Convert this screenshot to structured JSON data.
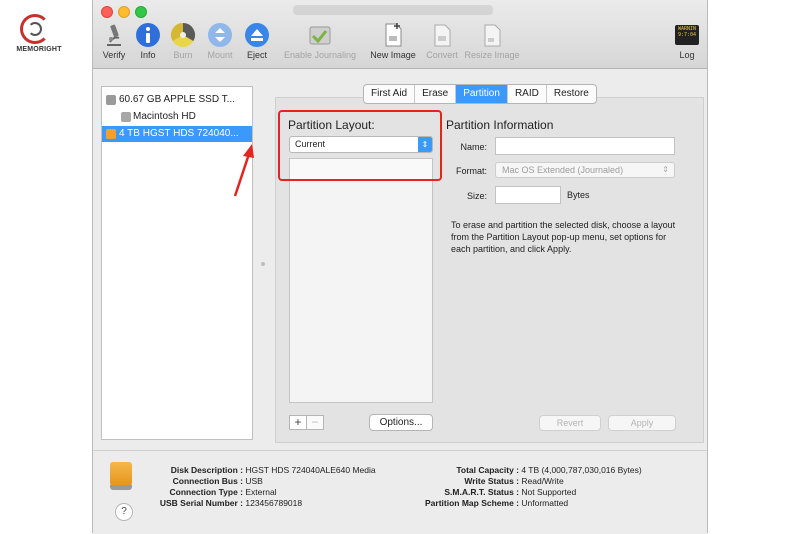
{
  "watermark": {
    "text": "MEMORIGHT"
  },
  "toolbar": {
    "items": [
      {
        "label": "Verify",
        "icon": "microscope-icon"
      },
      {
        "label": "Info",
        "icon": "info-icon"
      },
      {
        "label": "Burn",
        "icon": "burn-icon"
      },
      {
        "label": "Mount",
        "icon": "mount-icon"
      },
      {
        "label": "Eject",
        "icon": "eject-icon"
      },
      {
        "label": "Enable Journaling",
        "icon": "journaling-icon"
      },
      {
        "label": "New Image",
        "icon": "new-image-icon"
      },
      {
        "label": "Convert",
        "icon": "convert-icon"
      },
      {
        "label": "Resize Image",
        "icon": "resize-image-icon"
      },
      {
        "label": "Log",
        "icon": "log-icon"
      }
    ],
    "log_badge": "WARNIN 9:7:04"
  },
  "sidebar": {
    "items": [
      {
        "label": "60.67 GB APPLE SSD T..."
      },
      {
        "label": "Macintosh HD"
      },
      {
        "label": "4 TB HGST HDS 724040...",
        "selected": true
      }
    ]
  },
  "tabs": [
    {
      "label": "First Aid"
    },
    {
      "label": "Erase"
    },
    {
      "label": "Partition",
      "active": true
    },
    {
      "label": "RAID"
    },
    {
      "label": "Restore"
    }
  ],
  "partition_layout": {
    "title": "Partition Layout:",
    "selected": "Current",
    "add_label": "+",
    "remove_label": "−",
    "options_label": "Options..."
  },
  "partition_info": {
    "title": "Partition Information",
    "name_label": "Name:",
    "name_value": "",
    "format_label": "Format:",
    "format_value": "Mac OS Extended (Journaled)",
    "size_label": "Size:",
    "size_value": "",
    "size_unit": "Bytes",
    "help_text": "To erase and partition the selected disk, choose a layout from the Partition Layout pop-up menu, set options for each partition, and click Apply.",
    "revert_label": "Revert",
    "apply_label": "Apply"
  },
  "disk_info": {
    "left": [
      {
        "key": "Disk Description :",
        "value": "HGST HDS 724040ALE640 Media"
      },
      {
        "key": "Connection Bus :",
        "value": "USB"
      },
      {
        "key": "Connection Type :",
        "value": "External"
      },
      {
        "key": "USB Serial Number :",
        "value": "123456789018"
      }
    ],
    "right": [
      {
        "key": "Total Capacity :",
        "value": "4 TB (4,000,787,030,016 Bytes)"
      },
      {
        "key": "Write Status :",
        "value": "Read/Write"
      },
      {
        "key": "S.M.A.R.T. Status :",
        "value": "Not Supported"
      },
      {
        "key": "Partition Map Scheme :",
        "value": "Unformatted"
      }
    ],
    "help_label": "?"
  },
  "colors": {
    "accent": "#3b99fc",
    "annotation_red": "#e52420",
    "drive_orange": "#f0a030"
  }
}
